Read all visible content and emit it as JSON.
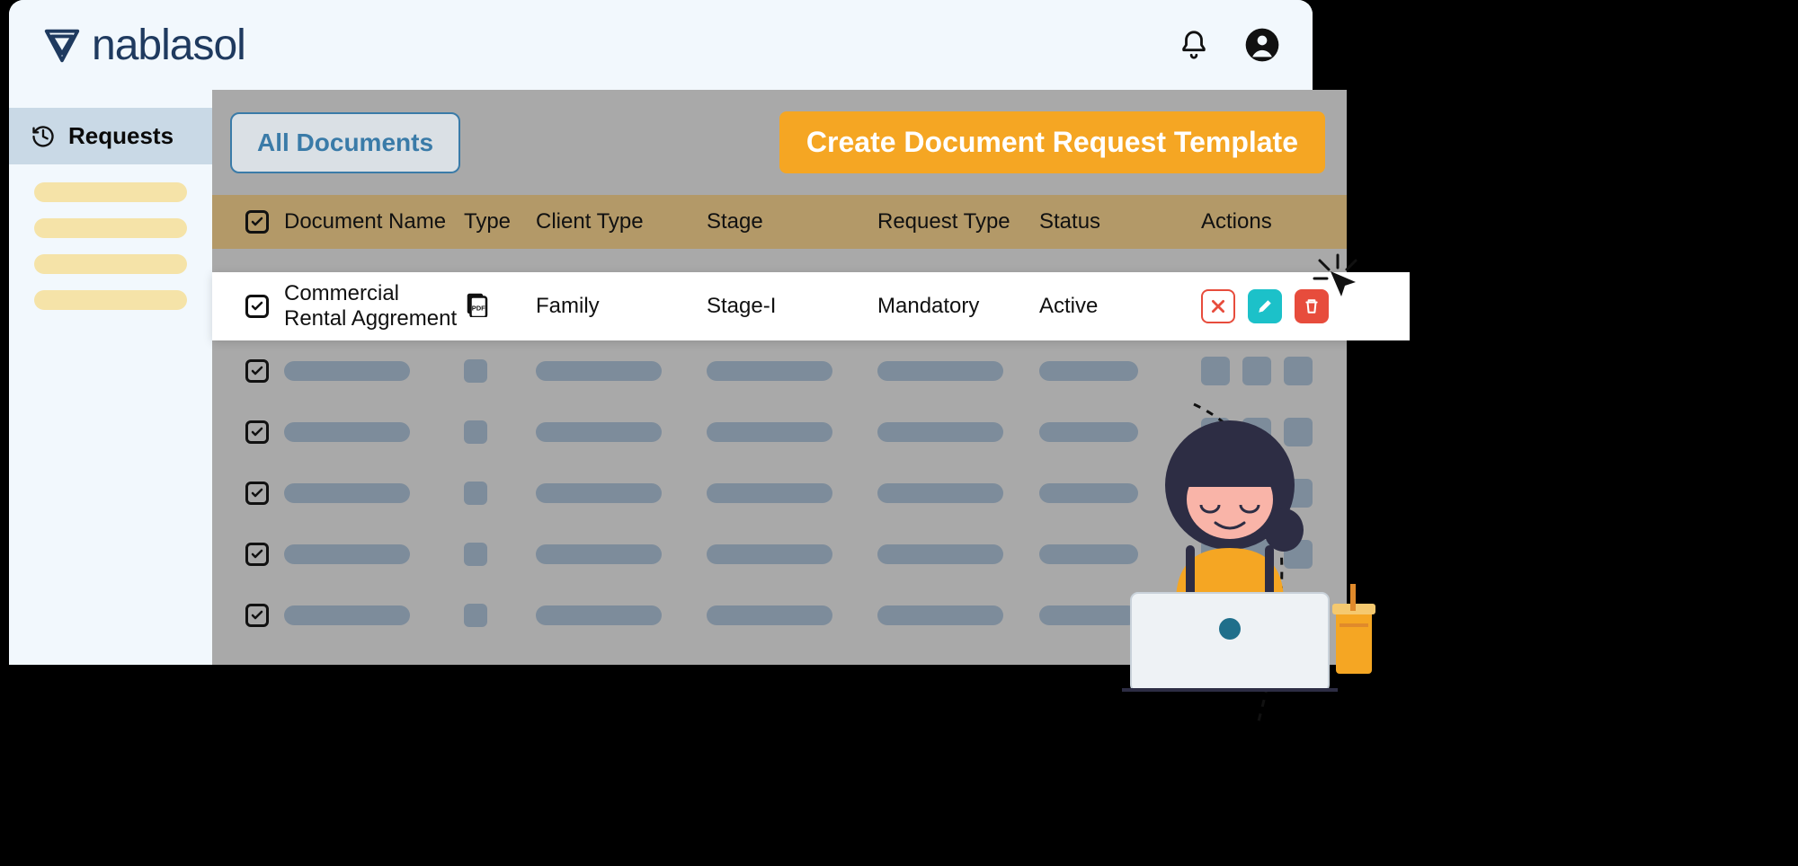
{
  "brand": {
    "name": "nablasol"
  },
  "sidebar": {
    "active_label": "Requests",
    "placeholder_count": 4
  },
  "toolbar": {
    "tab_label": "All Documents",
    "create_label": "Create Document Request Template"
  },
  "table": {
    "headers": {
      "name": "Document Name",
      "type": "Type",
      "client_type": "Client Type",
      "stage": "Stage",
      "request_type": "Request Type",
      "status": "Status",
      "actions": "Actions"
    },
    "active_row": {
      "name": "Commercial Rental Aggrement",
      "type_icon": "pdf-icon",
      "client_type": "Family",
      "stage": "Stage-I",
      "request_type": "Mandatory",
      "status": "Active"
    },
    "placeholder_row_count": 5
  },
  "icons": {
    "bell": "bell-icon",
    "user": "user-circle-icon",
    "history": "history-icon",
    "close": "close-icon",
    "edit": "pencil-icon",
    "trash": "trash-icon"
  },
  "colors": {
    "accent_orange": "#f5a623",
    "accent_teal": "#1cc1c9",
    "accent_red": "#e74c3c",
    "brand_navy": "#1f3a5f",
    "header_olive": "#b39968"
  }
}
